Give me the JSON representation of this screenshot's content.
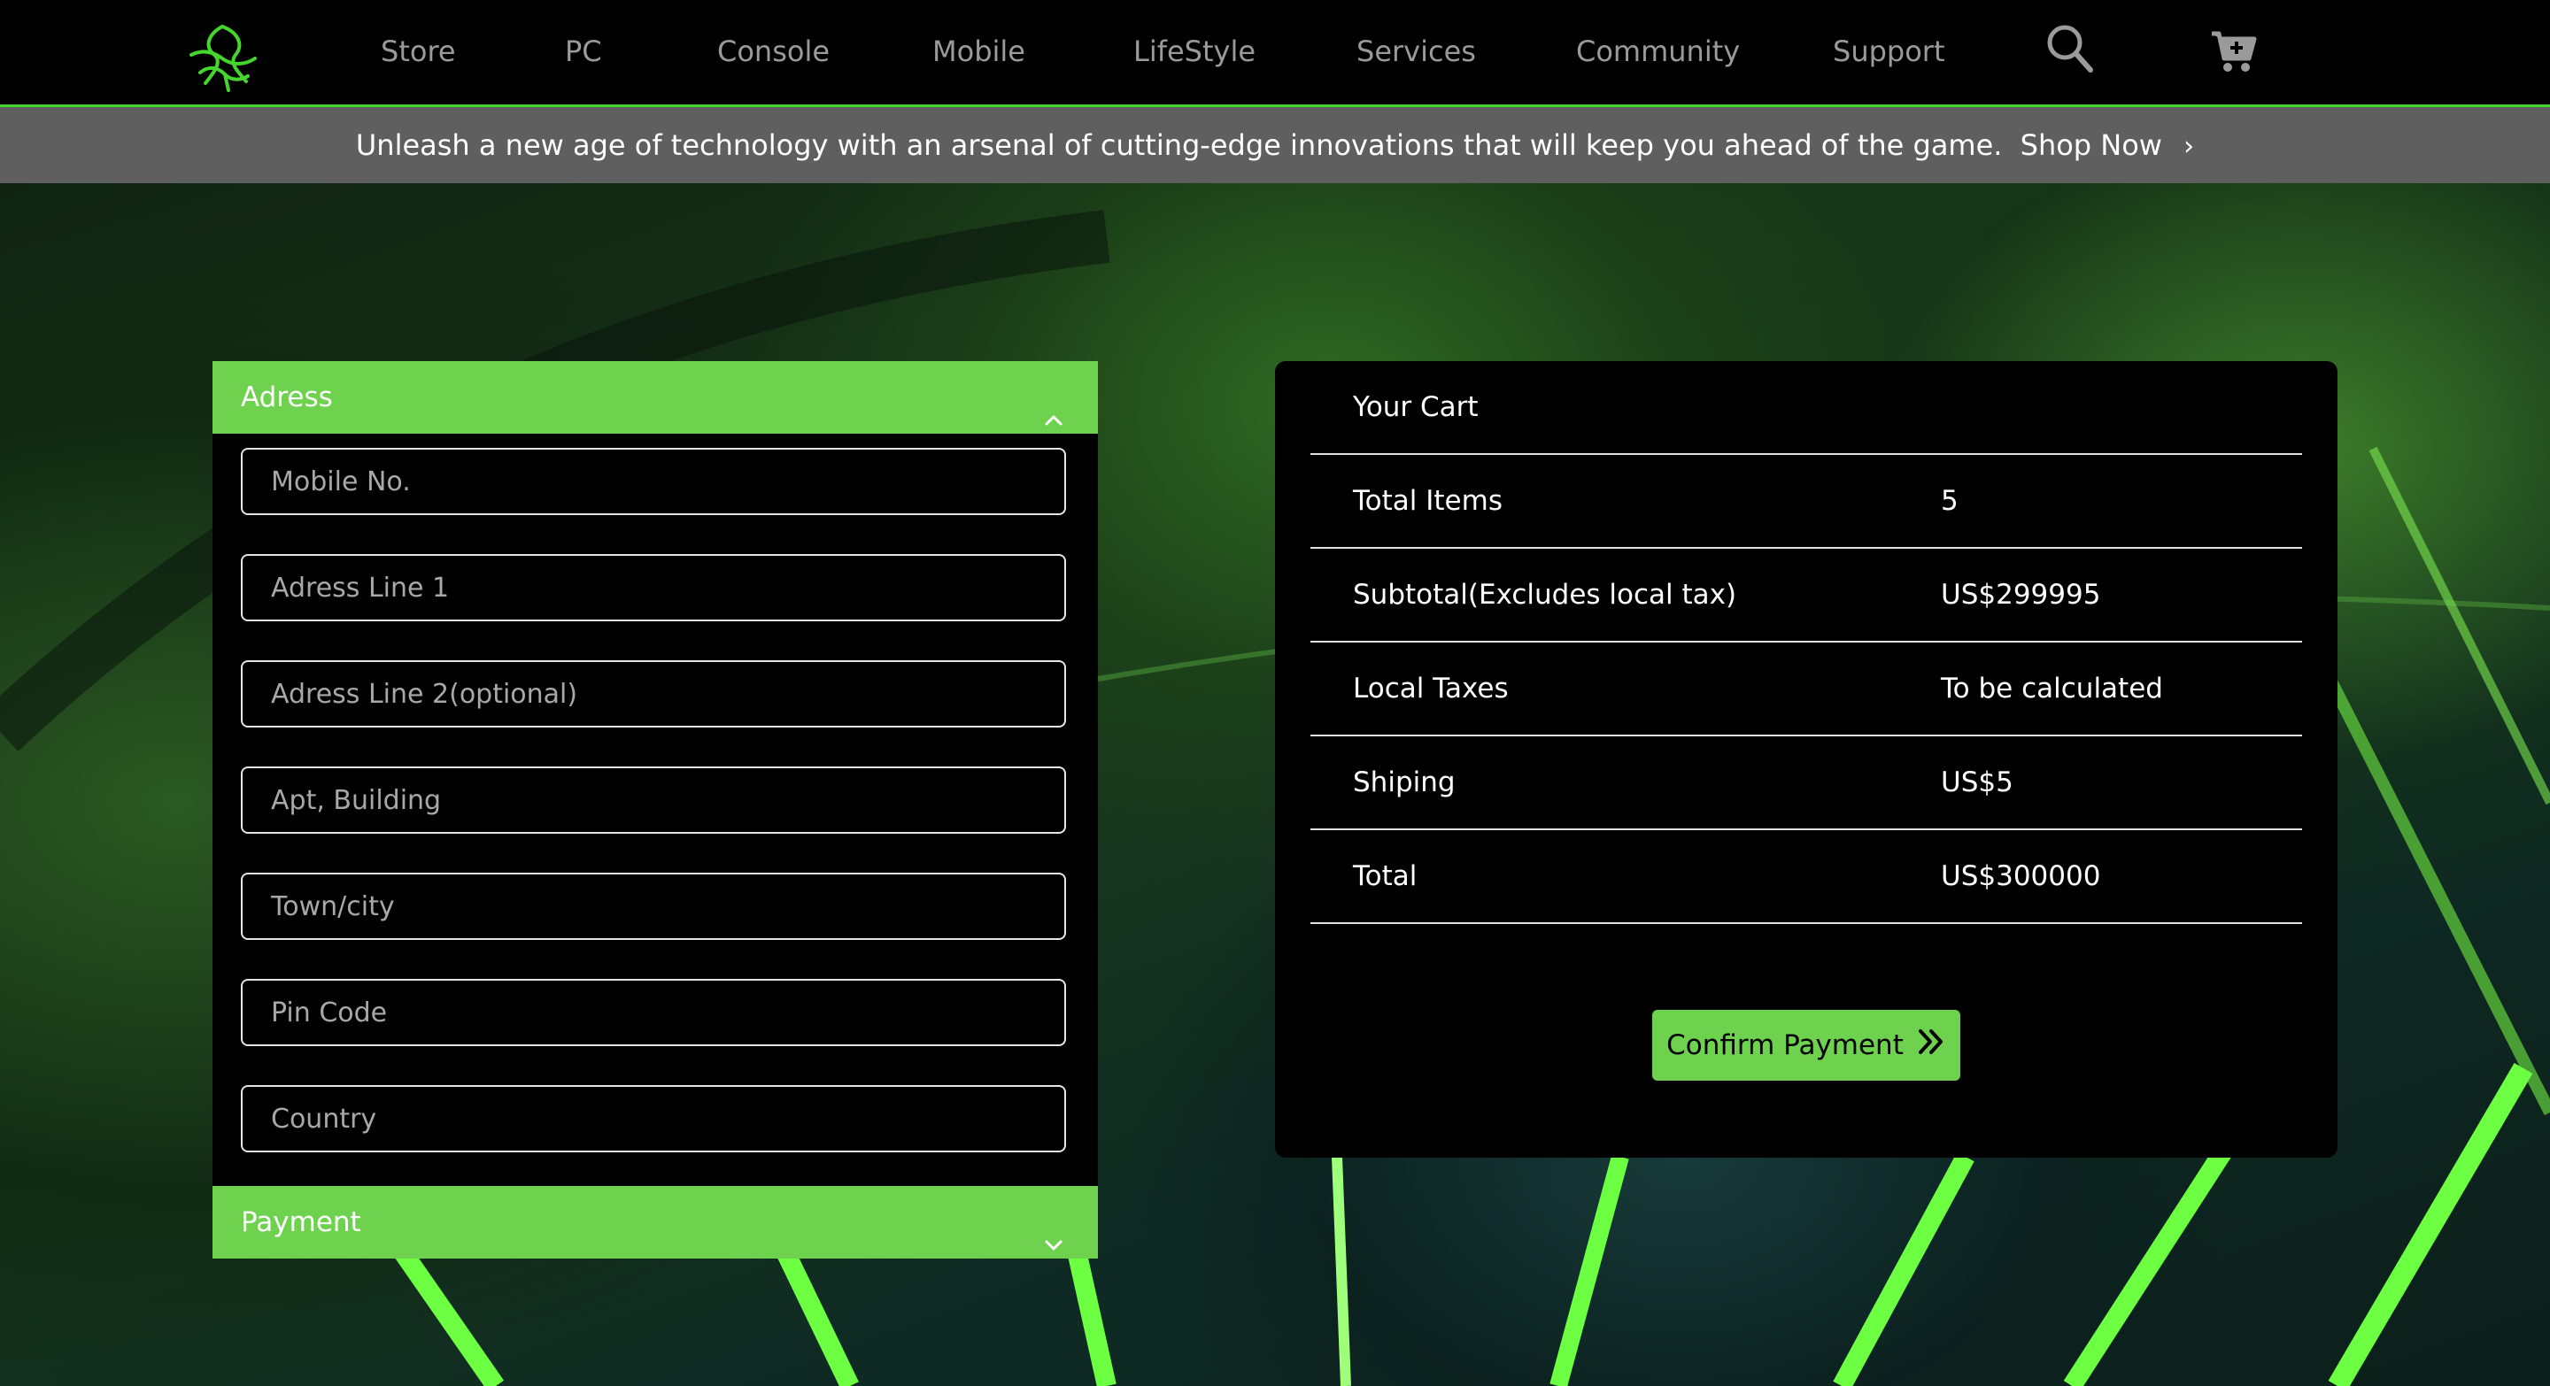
{
  "nav": {
    "items": [
      {
        "label": "Store"
      },
      {
        "label": "PC"
      },
      {
        "label": "Console"
      },
      {
        "label": "Mobile"
      },
      {
        "label": "LifeStyle"
      },
      {
        "label": "Services"
      },
      {
        "label": "Community"
      },
      {
        "label": "Support"
      }
    ],
    "icons": {
      "logo": "razer-logo-icon",
      "search": "search-icon",
      "cart": "cart-icon"
    }
  },
  "promo": {
    "text": "Unleash a new age of technology with an arsenal of cutting-edge innovations that will keep you ahead of the game.",
    "link": "Shop Now",
    "chevron": "›"
  },
  "address": {
    "heading": "Adress",
    "fields": [
      {
        "placeholder": "Mobile No.",
        "value": ""
      },
      {
        "placeholder": "Adress Line 1",
        "value": ""
      },
      {
        "placeholder": "Adress Line 2(optional)",
        "value": ""
      },
      {
        "placeholder": "Apt, Building",
        "value": ""
      },
      {
        "placeholder": "Town/city",
        "value": ""
      },
      {
        "placeholder": "Pin Code",
        "value": ""
      },
      {
        "placeholder": "Country",
        "value": ""
      }
    ]
  },
  "payment": {
    "heading": "Payment"
  },
  "cart": {
    "title": "Your Cart",
    "rows": [
      {
        "label": "Total Items",
        "value": "5"
      },
      {
        "label": "Subtotal(Excludes local tax)",
        "value": "US$299995"
      },
      {
        "label": "Local Taxes",
        "value": "To be calculated"
      },
      {
        "label": "Shiping",
        "value": "US$5"
      },
      {
        "label": "Total",
        "value": "US$300000"
      }
    ],
    "confirm_label": "Confirm Payment"
  },
  "colors": {
    "accent": "#6ed24f",
    "brand": "#44d62c",
    "promo_bg": "#5f5f5f"
  }
}
